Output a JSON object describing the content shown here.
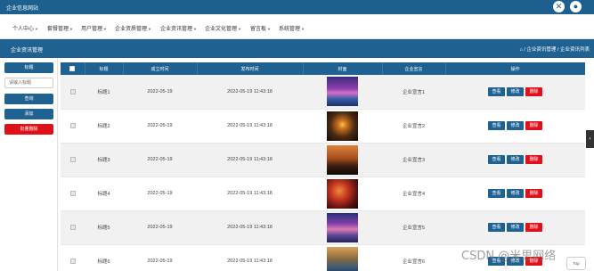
{
  "header": {
    "site_title": "企业信息网站",
    "icon_left": "close-circle-icon",
    "icon_right": "user-circle-icon"
  },
  "nav": {
    "items": [
      "个人中心",
      "套餐管理",
      "用户管理",
      "企业资质管理",
      "企业资讯管理",
      "企业文化管理",
      "留言板",
      "系统管理"
    ]
  },
  "page": {
    "title": "企业资讯管理",
    "breadcrumb": "⌂ / 企业资讯管理 / 企业资讯列表"
  },
  "sidebar": {
    "search_btn": "标题",
    "input_placeholder": "请输入标题",
    "query_btn": "查询",
    "add_btn": "添加",
    "batch_delete_btn": "批量删除"
  },
  "table": {
    "headers": [
      "",
      "标题",
      "成立时间",
      "发布时间",
      "封面",
      "企业宣言",
      "操作"
    ],
    "rows": [
      {
        "title": "标题1",
        "founded": "2022-05-19",
        "published": "2022-05-19 11:43:18",
        "motto": "企业宣言1"
      },
      {
        "title": "标题2",
        "founded": "2022-05-19",
        "published": "2022-05-19 11:43:18",
        "motto": "企业宣言2"
      },
      {
        "title": "标题3",
        "founded": "2022-05-19",
        "published": "2022-05-19 11:43:18",
        "motto": "企业宣言3"
      },
      {
        "title": "标题4",
        "founded": "2022-05-19",
        "published": "2022-05-19 11:43:18",
        "motto": "企业宣言4"
      },
      {
        "title": "标题5",
        "founded": "2022-05-19",
        "published": "2022-05-19 11:43:18",
        "motto": "企业宣言5"
      },
      {
        "title": "标题6",
        "founded": "2022-05-19",
        "published": "2022-05-19 11:43:18",
        "motto": "企业宣言6"
      }
    ],
    "actions": {
      "view": "查看",
      "edit": "修改",
      "delete": "删除"
    }
  },
  "misc": {
    "top_button": "Top",
    "watermark": "CSDN @米思网络"
  },
  "colors": {
    "primary": "#1f6292",
    "danger": "#e0101a",
    "topbar": "#1d5f8f"
  }
}
